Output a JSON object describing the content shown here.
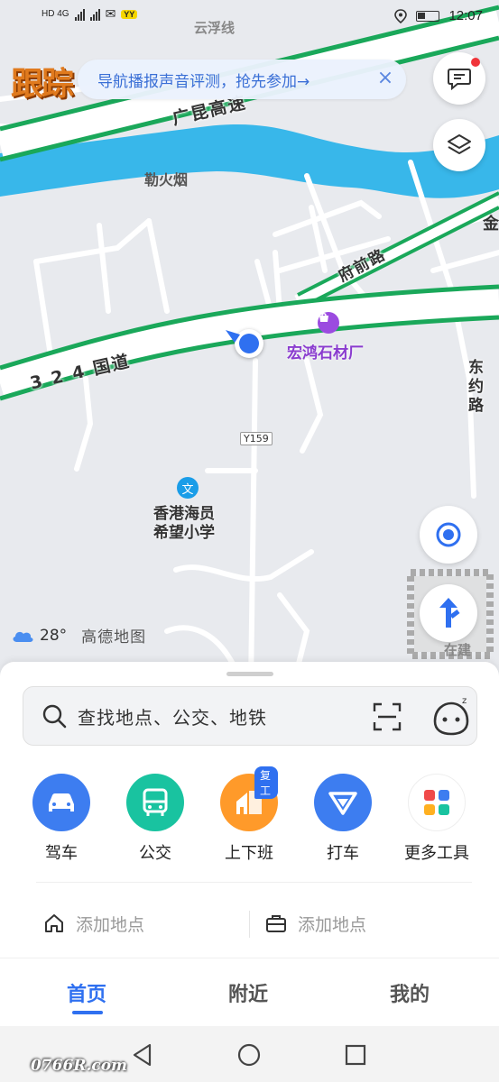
{
  "status_bar": {
    "network_left": "HD 4G",
    "time": "12:07",
    "badge": "YY"
  },
  "map": {
    "labels": {
      "top_road": "云浮线",
      "expressway": "广昆高速",
      "village1": "勒火烟",
      "right_edge": "金",
      "fuqian_road": "府前路",
      "guodao": "3 2 4 国道",
      "poi_stone": "宏鸿石材厂",
      "dongyue_road": "东约路",
      "road_code": "Y159",
      "school": "香港海员\n希望小学",
      "construction": "在建"
    },
    "logo_text": "跟踪",
    "banner": "导航播报声音评测，抢先参加→",
    "weather": {
      "temp": "28°",
      "brand": "高德地图"
    }
  },
  "search": {
    "placeholder": "查找地点、公交、地铁"
  },
  "tools": [
    {
      "label": "驾车",
      "icon": "car-icon",
      "color": "#3d7df0"
    },
    {
      "label": "公交",
      "icon": "bus-icon",
      "color": "#19c3a0"
    },
    {
      "label": "上下班",
      "icon": "commute-icon",
      "color": "#ff9a2a",
      "tag": "复工"
    },
    {
      "label": "打车",
      "icon": "taxi-icon",
      "color": "#3d7df0"
    },
    {
      "label": "更多工具",
      "icon": "more-tools-icon",
      "color": "#ffffff"
    }
  ],
  "places": {
    "home": "添加地点",
    "work": "添加地点"
  },
  "tabs": [
    {
      "label": "首页"
    },
    {
      "label": "附近"
    },
    {
      "label": "我的"
    }
  ],
  "watermark": "0766R.com"
}
